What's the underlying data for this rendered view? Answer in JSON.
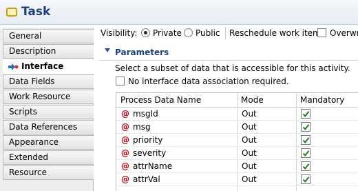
{
  "header": {
    "title": "Task"
  },
  "sidebar": {
    "tabs": [
      {
        "label": "General"
      },
      {
        "label": "Description"
      },
      {
        "label": "Interface"
      },
      {
        "label": "Data Fields"
      },
      {
        "label": "Work Resource"
      },
      {
        "label": "Scripts"
      },
      {
        "label": "Data References"
      },
      {
        "label": "Appearance"
      },
      {
        "label": "Extended"
      },
      {
        "label": "Resource"
      }
    ],
    "active_tab": "Interface"
  },
  "visibility": {
    "label": "Visibility:",
    "options": [
      "Private",
      "Public"
    ],
    "selected": "Private"
  },
  "reschedule": {
    "label": "Reschedule work item:",
    "checkbox_label": "Overwri",
    "checked": false
  },
  "parameters": {
    "title": "Parameters",
    "description": "Select a subset of data that is accessible for this activity.",
    "no_association_label": "No interface data association required.",
    "no_association_checked": false,
    "columns": [
      "Process Data Name",
      "Mode",
      "Mandatory"
    ],
    "rows": [
      {
        "name": "msgId",
        "mode": "Out",
        "mandatory": true
      },
      {
        "name": "msg",
        "mode": "Out",
        "mandatory": true
      },
      {
        "name": "priority",
        "mode": "Out",
        "mandatory": true
      },
      {
        "name": "severity",
        "mode": "Out",
        "mandatory": true
      },
      {
        "name": "attrName",
        "mode": "Out",
        "mandatory": true
      },
      {
        "name": "attrVal",
        "mode": "Out",
        "mandatory": true
      }
    ]
  }
}
